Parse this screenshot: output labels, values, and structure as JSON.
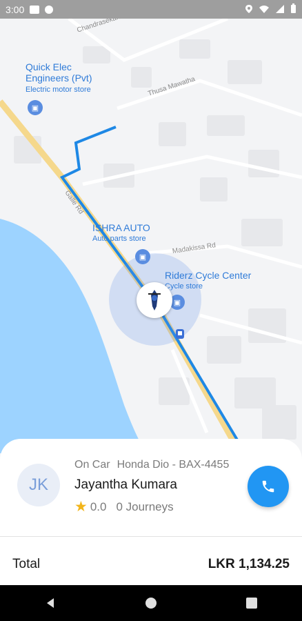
{
  "status_bar": {
    "time": "3:00"
  },
  "map": {
    "road_labels": [
      "Chandrasekara Rd",
      "Thusa Mawatha",
      "Madakissa Rd",
      "Galle Rd"
    ],
    "places": [
      {
        "name": "Quick Elec\nEngineers (Pvt)",
        "category": "Electric motor store"
      },
      {
        "name": "ISHRA AUTO",
        "category": "Auto parts store"
      },
      {
        "name": "Riderz Cycle Center",
        "category": "Cycle store"
      }
    ]
  },
  "driver": {
    "initials": "JK",
    "vehicle_type": "On Car",
    "vehicle": "Honda Dio - BAX-4455",
    "name": "Jayantha Kumara",
    "rating": "0.0",
    "journeys": "0 Journeys"
  },
  "total": {
    "label": "Total",
    "value": "LKR 1,134.25"
  },
  "colors": {
    "accent": "#2196f3",
    "route": "#1e88e5",
    "highway": "#f5d88c",
    "water": "#9dd3ff"
  },
  "icons": [
    "phone-icon",
    "star-icon",
    "shopping-bag-icon",
    "motorbike-icon",
    "bus-stop-icon"
  ]
}
